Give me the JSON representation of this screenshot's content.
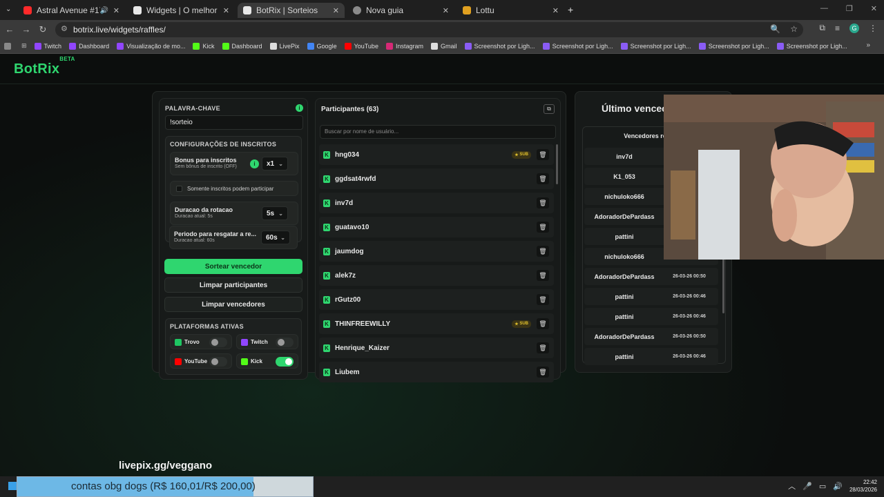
{
  "browser": {
    "tabs": [
      {
        "label": "Astral Avenue #17 Winter 2",
        "favicon_color": "#ff2a2a",
        "active": false
      },
      {
        "label": "Widgets | O melhor software p",
        "favicon_color": "#e8e8e8",
        "active": false
      },
      {
        "label": "BotRix | Sorteios",
        "favicon_color": "#e8e8e8",
        "active": true
      },
      {
        "label": "Nova guia",
        "favicon_color": "#8a8a8a",
        "active": false
      },
      {
        "label": "Lottu",
        "favicon_color": "#e0a020",
        "active": false
      }
    ],
    "url": "botrix.live/widgets/raffles/",
    "bookmarks": [
      {
        "label": "Twitch",
        "color": "#9146ff"
      },
      {
        "label": "Dashboard",
        "color": "#9146ff"
      },
      {
        "label": "Visualização de mo...",
        "color": "#9146ff"
      },
      {
        "label": "Kick",
        "color": "#53fc18"
      },
      {
        "label": "Dashboard",
        "color": "#53fc18"
      },
      {
        "label": "LivePix",
        "color": "#dddddd"
      },
      {
        "label": "Google",
        "color": "#4285f4"
      },
      {
        "label": "YouTube",
        "color": "#ff0000"
      },
      {
        "label": "Instagram",
        "color": "#d62976"
      },
      {
        "label": "Gmail",
        "color": "#dddddd"
      },
      {
        "label": "Screenshot por Ligh...",
        "color": "#8a5cf5"
      },
      {
        "label": "Screenshot por Ligh...",
        "color": "#8a5cf5"
      },
      {
        "label": "Screenshot por Ligh...",
        "color": "#8a5cf5"
      },
      {
        "label": "Screenshot por Ligh...",
        "color": "#8a5cf5"
      },
      {
        "label": "Screenshot por Ligh...",
        "color": "#8a5cf5"
      }
    ],
    "profile_initial": "G"
  },
  "app": {
    "logo": "BotRix",
    "logo_badge": "BETA",
    "accent": "#2fd66f"
  },
  "settings": {
    "keyword_title": "PALAVRA-CHAVE",
    "keyword_value": "!sorteio",
    "subs_title": "CONFIGURAÇÕES DE INSCRITOS",
    "bonus_label": "Bonus para inscritos",
    "bonus_sub": "Sem bônus de inscrito (OFF)",
    "bonus_value": "x1",
    "subs_only_label": "Somente inscritos podem participar",
    "rotation_label": "Duracao da rotacao",
    "rotation_sub": "Duracao atual: 5s",
    "rotation_value": "5s",
    "claim_label": "Periodo para resgatar a re...",
    "claim_sub": "Duracao atual: 60s",
    "claim_value": "60s",
    "draw_button": "Sortear vencedor",
    "clear_participants_button": "Limpar participantes",
    "clear_winners_button": "Limpar vencedores",
    "platforms_title": "PLATAFORMAS ATIVAS",
    "platforms": [
      {
        "label": "Trovo",
        "color": "#1ec762",
        "enabled": false
      },
      {
        "label": "Twitch",
        "color": "#9146ff",
        "enabled": false
      },
      {
        "label": "YouTube",
        "color": "#ff0000",
        "enabled": false
      },
      {
        "label": "Kick",
        "color": "#53fc18",
        "enabled": true
      }
    ]
  },
  "participants": {
    "title": "Participantes (63)",
    "search_placeholder": "Buscar por nome de usuário...",
    "sub_badge": "SUB",
    "items": [
      {
        "name": "hng034",
        "sub": true
      },
      {
        "name": "ggdsat4rwfd",
        "sub": false
      },
      {
        "name": "inv7d",
        "sub": false
      },
      {
        "name": "guatavo10",
        "sub": false
      },
      {
        "name": "jaumdog",
        "sub": false
      },
      {
        "name": "alek7z",
        "sub": false
      },
      {
        "name": "rGutz00",
        "sub": false
      },
      {
        "name": "THINFREEWILLY",
        "sub": true
      },
      {
        "name": "Henrique_Kaizer",
        "sub": false
      },
      {
        "name": "Liubem",
        "sub": false
      }
    ]
  },
  "winners": {
    "title": "Último vencec",
    "header": "Vencedores re",
    "items": [
      {
        "name": "inv7d",
        "date": "28-03-"
      },
      {
        "name": "K1_053",
        "date": "28-03"
      },
      {
        "name": "nichuloko666",
        "date": "2"
      },
      {
        "name": "AdoradorDePardass",
        "date": ""
      },
      {
        "name": "pattini",
        "date": "26-03"
      },
      {
        "name": "nichuloko666",
        "date": "2"
      },
      {
        "name": "AdoradorDePardass",
        "date": "26-03-26 00:50"
      },
      {
        "name": "pattini",
        "date": "26-03-26 00:46"
      },
      {
        "name": "pattini",
        "date": "26-03-26 00:46"
      },
      {
        "name": "AdoradorDePardass",
        "date": "26-03-26 00:50"
      },
      {
        "name": "pattini",
        "date": "26-03-26 00:46"
      }
    ]
  },
  "overlay": {
    "livepix": "livepix.gg/veggano",
    "goal_text": "contas obg dogs (R$ 160,01/R$ 200,00)",
    "goal_progress": 0.8
  },
  "taskbar": {
    "time": "22:42",
    "date": "28/03/2026"
  }
}
